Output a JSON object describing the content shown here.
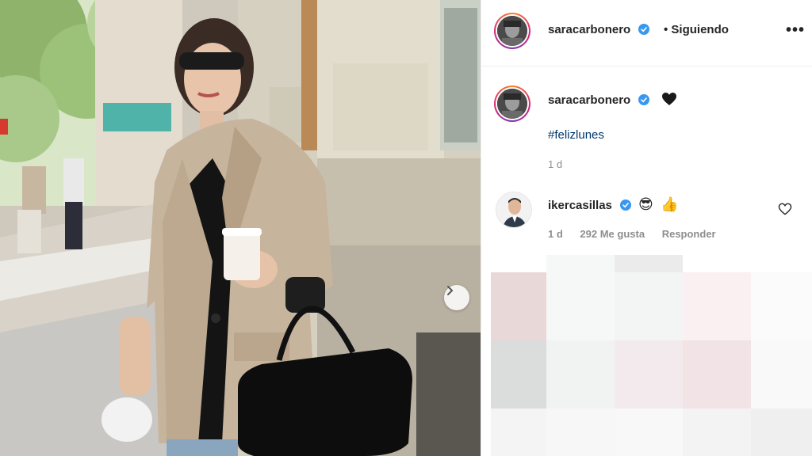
{
  "post": {
    "author": "saracarbonero",
    "follow_status": "• Siguiendo",
    "more_label": "•••",
    "caption": {
      "author": "saracarbonero",
      "hashtag": "#felizlunes",
      "time": "1 d"
    },
    "comments": [
      {
        "author": "ikercasillas",
        "emojis": [
          "😎",
          "👍"
        ],
        "time": "1 d",
        "likes": "292 Me gusta",
        "reply_label": "Responder"
      }
    ]
  },
  "colors": {
    "verified": "#3897f0",
    "link": "#00376b",
    "muted": "#8e8e8e"
  },
  "icons": {
    "verified": "verified-badge-icon",
    "black_heart": "black-heart-icon",
    "like": "heart-outline-icon",
    "next": "chevron-right-icon",
    "more": "more-options-icon"
  }
}
